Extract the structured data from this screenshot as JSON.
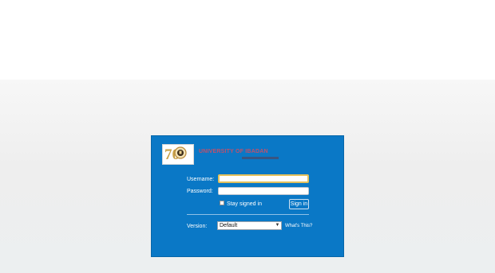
{
  "login": {
    "university_name": "UNIVERSITY OF IBADAN",
    "logo_text": "70",
    "username_label": "Username:",
    "username_value": "",
    "password_label": "Password:",
    "password_value": "",
    "stay_signed_in_label": "Stay signed in",
    "stay_signed_in_checked": false,
    "sign_in_label": "Sign in",
    "version_label": "Version:",
    "version_value": "Default",
    "whats_this_label": "What's This?"
  },
  "colors": {
    "panel_blue": "#0a78c6",
    "focus_gold": "#e4c15b",
    "brand_text": "#c2506a"
  }
}
